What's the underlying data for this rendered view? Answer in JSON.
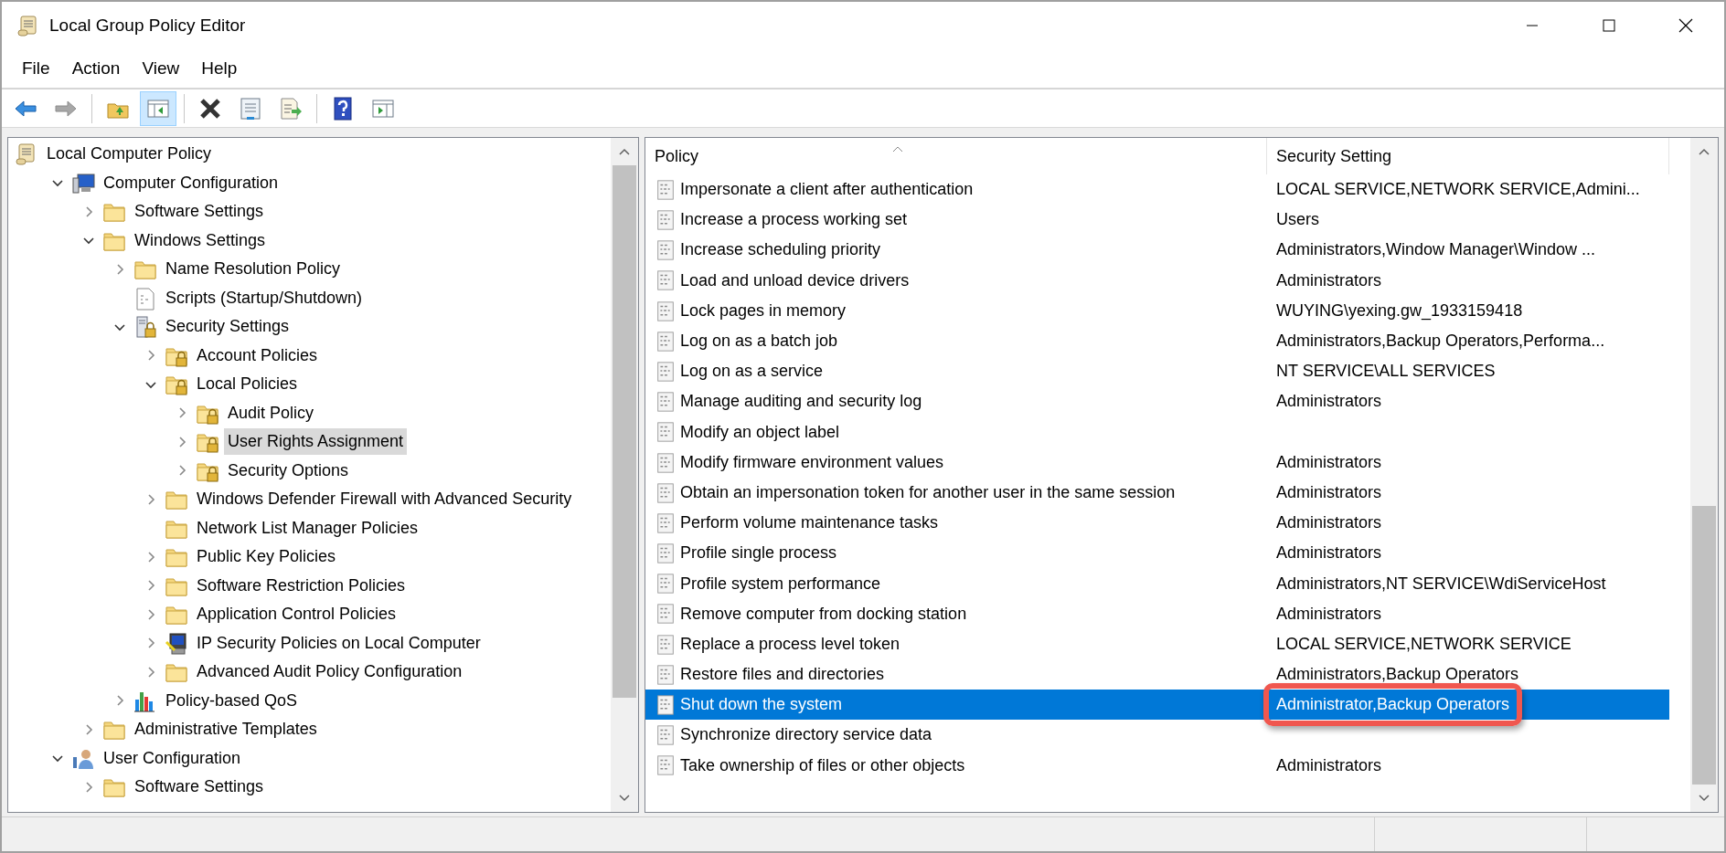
{
  "window": {
    "title": "Local Group Policy Editor"
  },
  "menu": [
    "File",
    "Action",
    "View",
    "Help"
  ],
  "toolbar": [
    {
      "kind": "back",
      "pressed": false,
      "disabled": false
    },
    {
      "kind": "forward",
      "pressed": false,
      "disabled": true
    },
    {
      "kind": "sep"
    },
    {
      "kind": "up",
      "pressed": false,
      "disabled": false
    },
    {
      "kind": "tree",
      "pressed": true,
      "disabled": false
    },
    {
      "kind": "sep"
    },
    {
      "kind": "delete",
      "pressed": false,
      "disabled": false
    },
    {
      "kind": "properties",
      "pressed": false,
      "disabled": false
    },
    {
      "kind": "export",
      "pressed": false,
      "disabled": false
    },
    {
      "kind": "sep"
    },
    {
      "kind": "help",
      "pressed": false,
      "disabled": false
    },
    {
      "kind": "actionpane",
      "pressed": false,
      "disabled": false
    }
  ],
  "tree": [
    {
      "label": "Local Computer Policy",
      "kind": "policy",
      "selected": false,
      "children": [
        {
          "label": "Computer Configuration",
          "kind": "computer",
          "expanded": true,
          "selected": false,
          "children": [
            {
              "label": "Software Settings",
              "kind": "folder",
              "expanded": false,
              "selected": false
            },
            {
              "label": "Windows Settings",
              "kind": "folder",
              "expanded": true,
              "selected": false,
              "children": [
                {
                  "label": "Name Resolution Policy",
                  "kind": "folder",
                  "expanded": false,
                  "selected": false
                },
                {
                  "label": "Scripts (Startup/Shutdown)",
                  "kind": "script",
                  "selected": false
                },
                {
                  "label": "Security Settings",
                  "kind": "security",
                  "expanded": true,
                  "selected": false,
                  "children": [
                    {
                      "label": "Account Policies",
                      "kind": "lockfolder",
                      "expanded": false,
                      "selected": false
                    },
                    {
                      "label": "Local Policies",
                      "kind": "lockfolder",
                      "expanded": true,
                      "selected": false,
                      "children": [
                        {
                          "label": "Audit Policy",
                          "kind": "lockfolder",
                          "expanded": false,
                          "selected": false
                        },
                        {
                          "label": "User Rights Assignment",
                          "kind": "lockfolder",
                          "expanded": false,
                          "selected": true
                        },
                        {
                          "label": "Security Options",
                          "kind": "lockfolder",
                          "expanded": false,
                          "selected": false
                        }
                      ]
                    },
                    {
                      "label": "Windows Defender Firewall with Advanced Security",
                      "kind": "folder",
                      "expanded": false,
                      "selected": false
                    },
                    {
                      "label": "Network List Manager Policies",
                      "kind": "folder",
                      "selected": false
                    },
                    {
                      "label": "Public Key Policies",
                      "kind": "folder",
                      "expanded": false,
                      "selected": false
                    },
                    {
                      "label": "Software Restriction Policies",
                      "kind": "folder",
                      "expanded": false,
                      "selected": false
                    },
                    {
                      "label": "Application Control Policies",
                      "kind": "folder",
                      "expanded": false,
                      "selected": false
                    },
                    {
                      "label": "IP Security Policies on Local Computer",
                      "kind": "ipsec",
                      "expanded": false,
                      "selected": false
                    },
                    {
                      "label": "Advanced Audit Policy Configuration",
                      "kind": "folder",
                      "expanded": false,
                      "selected": false
                    }
                  ]
                },
                {
                  "label": "Policy-based QoS",
                  "kind": "qos",
                  "expanded": false,
                  "selected": false
                }
              ]
            },
            {
              "label": "Administrative Templates",
              "kind": "folder",
              "expanded": false,
              "selected": false
            }
          ]
        },
        {
          "label": "User Configuration",
          "kind": "user",
          "expanded": true,
          "selected": false,
          "children": [
            {
              "label": "Software Settings",
              "kind": "folder",
              "expanded": false,
              "selected": false
            }
          ]
        }
      ]
    }
  ],
  "table": {
    "columns": [
      "Policy",
      "Security Setting"
    ],
    "rows": [
      {
        "policy": "Impersonate a client after authentication",
        "setting": "LOCAL SERVICE,NETWORK SERVICE,Admini...",
        "selected": false,
        "annotated": false
      },
      {
        "policy": "Increase a process working set",
        "setting": "Users",
        "selected": false,
        "annotated": false
      },
      {
        "policy": "Increase scheduling priority",
        "setting": "Administrators,Window Manager\\Window ...",
        "selected": false,
        "annotated": false
      },
      {
        "policy": "Load and unload device drivers",
        "setting": "Administrators",
        "selected": false,
        "annotated": false
      },
      {
        "policy": "Lock pages in memory",
        "setting": "WUYING\\yexing.gw_1933159418",
        "selected": false,
        "annotated": false
      },
      {
        "policy": "Log on as a batch job",
        "setting": "Administrators,Backup Operators,Performa...",
        "selected": false,
        "annotated": false
      },
      {
        "policy": "Log on as a service",
        "setting": "NT SERVICE\\ALL SERVICES",
        "selected": false,
        "annotated": false
      },
      {
        "policy": "Manage auditing and security log",
        "setting": "Administrators",
        "selected": false,
        "annotated": false
      },
      {
        "policy": "Modify an object label",
        "selected": false,
        "annotated": false
      },
      {
        "policy": "Modify firmware environment values",
        "setting": "Administrators",
        "selected": false,
        "annotated": false
      },
      {
        "policy": "Obtain an impersonation token for another user in the same session",
        "setting": "Administrators",
        "selected": false,
        "annotated": false
      },
      {
        "policy": "Perform volume maintenance tasks",
        "setting": "Administrators",
        "selected": false,
        "annotated": false
      },
      {
        "policy": "Profile single process",
        "setting": "Administrators",
        "selected": false,
        "annotated": false
      },
      {
        "policy": "Profile system performance",
        "setting": "Administrators,NT SERVICE\\WdiServiceHost",
        "selected": false,
        "annotated": false
      },
      {
        "policy": "Remove computer from docking station",
        "setting": "Administrators",
        "selected": false,
        "annotated": false
      },
      {
        "policy": "Replace a process level token",
        "setting": "LOCAL SERVICE,NETWORK SERVICE",
        "selected": false,
        "annotated": false
      },
      {
        "policy": "Restore files and directories",
        "setting": "Administrators,Backup Operators",
        "selected": false,
        "annotated": false
      },
      {
        "policy": "Shut down the system",
        "setting": "Administrator,Backup Operators",
        "selected": true,
        "annotated": true
      },
      {
        "policy": "Synchronize directory service data",
        "selected": false,
        "annotated": false
      },
      {
        "policy": "Take ownership of files or other objects",
        "setting": "Administrators",
        "selected": false,
        "annotated": false
      }
    ]
  }
}
